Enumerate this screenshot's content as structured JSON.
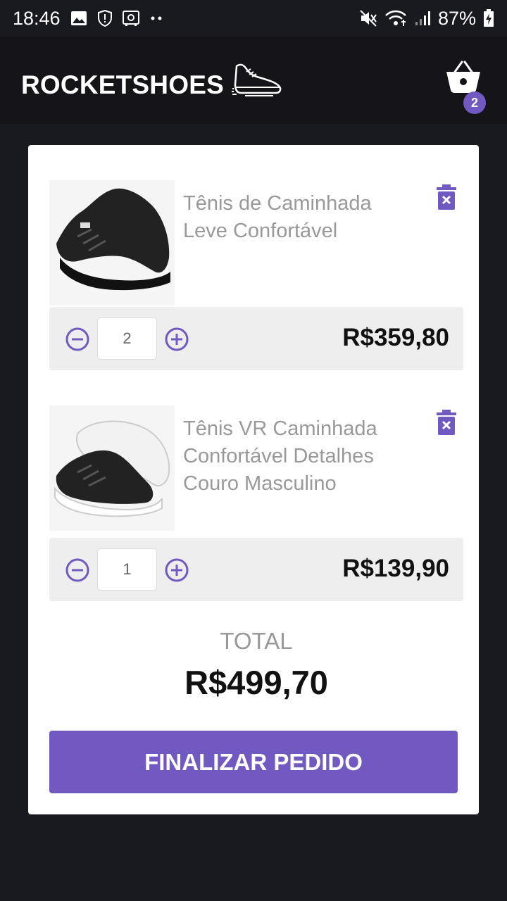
{
  "status_bar": {
    "time": "18:46",
    "battery": "87%"
  },
  "header": {
    "brand": "ROCKETSHOES",
    "cart_count": "2"
  },
  "cart": {
    "items": [
      {
        "title": "Tênis de Caminhada Leve Confortável",
        "quantity": "2",
        "subtotal": "R$359,80"
      },
      {
        "title": "Tênis VR Caminhada Confortável Detalhes Couro Masculino",
        "quantity": "1",
        "subtotal": "R$139,90"
      }
    ],
    "total_label": "TOTAL",
    "total_value": "R$499,70",
    "checkout_label": "FINALIZAR PEDIDO"
  },
  "colors": {
    "accent": "#7159c1",
    "background": "#191920",
    "header": "#141419"
  }
}
